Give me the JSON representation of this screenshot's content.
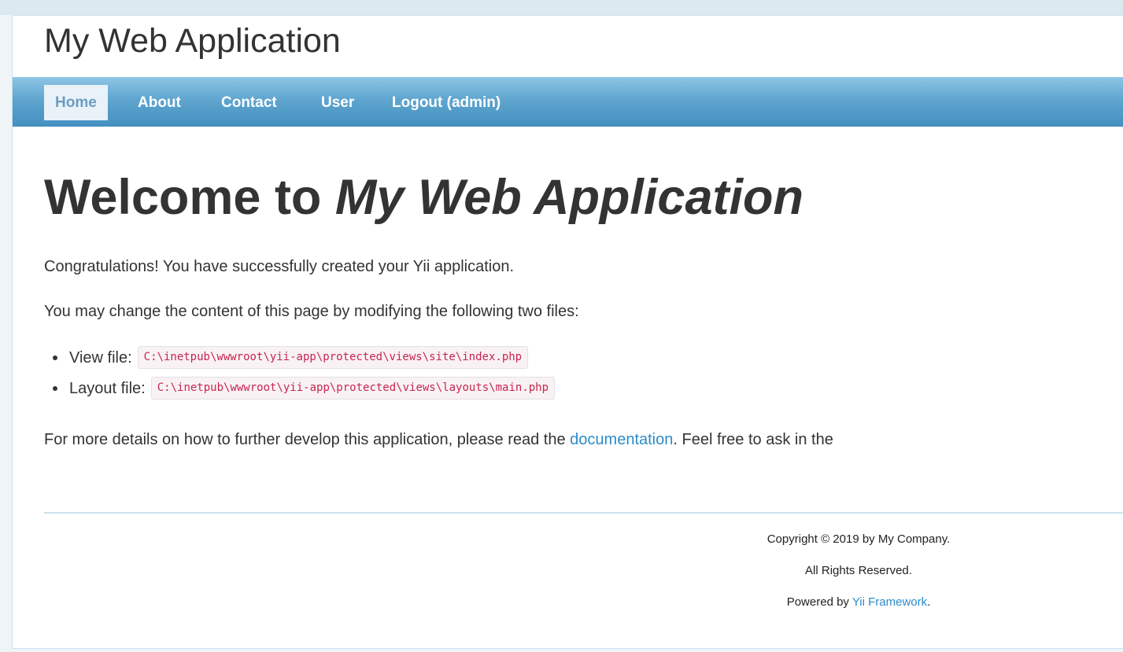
{
  "header": {
    "title": "My Web Application"
  },
  "menu": {
    "items": [
      {
        "label": "Home",
        "active": true
      },
      {
        "label": "About",
        "active": false
      },
      {
        "label": "Contact",
        "active": false
      },
      {
        "label": "User",
        "active": false
      },
      {
        "label": "Logout (admin)",
        "active": false
      }
    ]
  },
  "main": {
    "welcome_prefix": "Welcome to",
    "welcome_app": "My Web Application",
    "congrats": "Congratulations! You have successfully created your Yii application.",
    "change_text": "You may change the content of this page by modifying the following two files:",
    "files": [
      {
        "label": "View file:",
        "path": "C:\\inetpub\\wwwroot\\yii-app\\protected\\views\\site\\index.php"
      },
      {
        "label": "Layout file:",
        "path": "C:\\inetpub\\wwwroot\\yii-app\\protected\\views\\layouts\\main.php"
      }
    ],
    "details_prefix": "For more details on how to further develop this application, please read the",
    "details_link": "documentation",
    "details_suffix": ". Feel free to ask in the"
  },
  "footer": {
    "copyright": "Copyright © 2019 by My Company.",
    "rights": "All Rights Reserved.",
    "powered_prefix": "Powered by",
    "powered_link": "Yii Framework",
    "powered_suffix": "."
  },
  "colors": {
    "menu_gradient_top": "#8fc6e6",
    "menu_gradient_bottom": "#4390c0",
    "link": "#2b8cc8",
    "code_text": "#c7254e"
  }
}
